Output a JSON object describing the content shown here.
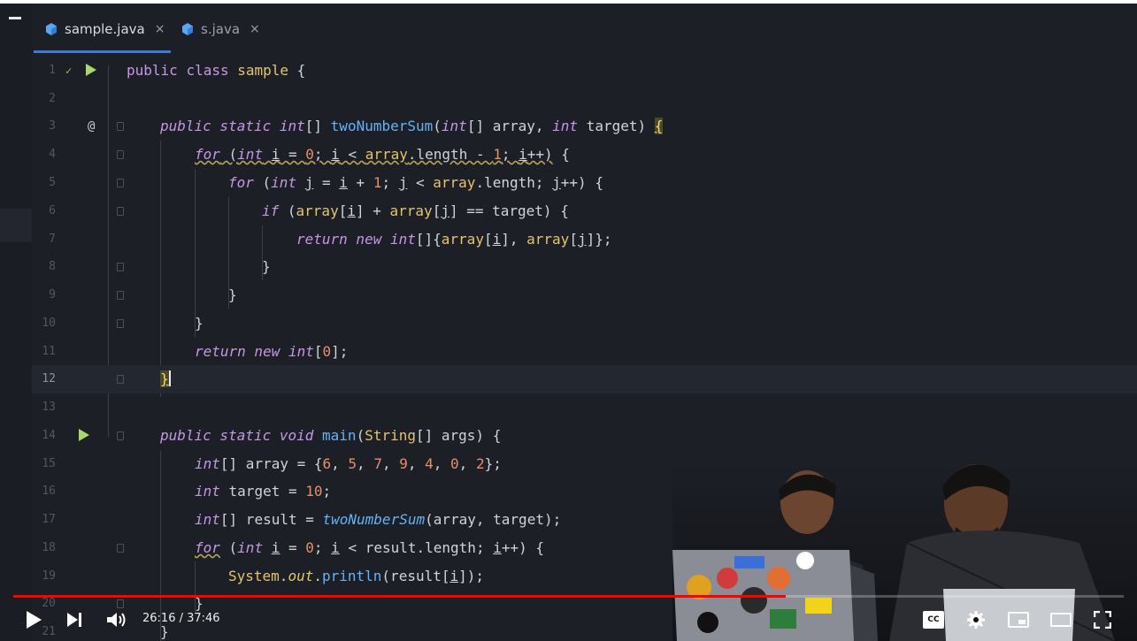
{
  "tabs": [
    {
      "label": "sample.java",
      "close": "×"
    },
    {
      "label": "s.java",
      "close": "×"
    }
  ],
  "line_numbers": [
    "1",
    "2",
    "3",
    "4",
    "5",
    "6",
    "7",
    "8",
    "9",
    "10",
    "11",
    "12",
    "13",
    "14",
    "15",
    "16",
    "17",
    "18",
    "19",
    "20",
    "21"
  ],
  "gutter": {
    "at_symbol": "@"
  },
  "player": {
    "time": "26:16 / 37:46",
    "progress": 0.696,
    "cc_label": "CC"
  },
  "colors": {
    "progress": "#ff0000",
    "tab_underline": "#3a7bd5",
    "keyword": "#c597e6",
    "function": "#66b2f5",
    "number": "#e88e6a"
  }
}
